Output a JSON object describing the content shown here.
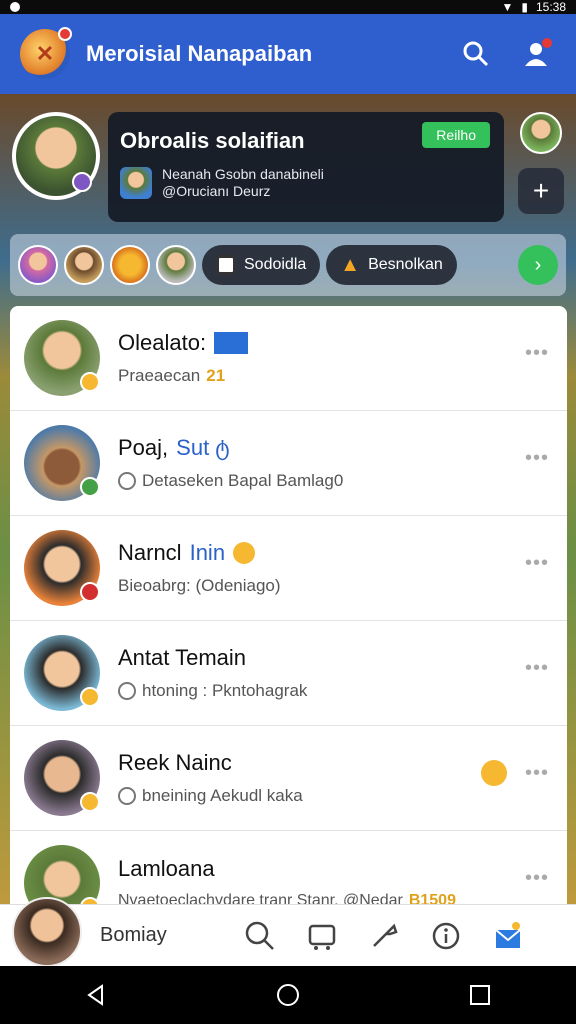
{
  "status_bar": {
    "time": "15:38"
  },
  "app_bar": {
    "title": "Meroisial Nanapaiban"
  },
  "hero": {
    "card_title": "Obroalis solaifian",
    "join_label": "Reilho",
    "sub_line1": "Neanah Gsobn danabineli",
    "sub_line2": "@Orucianı Deurz"
  },
  "stories": {
    "chip1_label": "Sodoidla",
    "chip2_label": "Besnolkan"
  },
  "chats": [
    {
      "name": "Olealato:",
      "extra": "",
      "preview": "Praeaecan",
      "preview_extra": "21"
    },
    {
      "name": "Poaj,",
      "extra": "Sut ტ",
      "preview": "Detaseken Bapal Bamlag0",
      "preview_extra": ""
    },
    {
      "name": "Narncl",
      "extra": "Inin",
      "preview": "Bieoabrg: (Odeniago)",
      "preview_extra": ""
    },
    {
      "name": "Antat Temain",
      "extra": "",
      "preview": "htoning : Pkntohagrak",
      "preview_extra": ""
    },
    {
      "name": "Reek Nainc",
      "extra": "",
      "preview": "bneining Aekudl kaka",
      "preview_extra": ""
    },
    {
      "name": "Lamloana",
      "extra": "",
      "preview": "Nvaetoeclachvdare tranr Stanr, @Nedar",
      "preview_extra": "B1509"
    }
  ],
  "bottom_bar": {
    "label": "Bomiay"
  },
  "colors": {
    "primary": "#2f5fcf",
    "accent_green": "#34c05a"
  }
}
